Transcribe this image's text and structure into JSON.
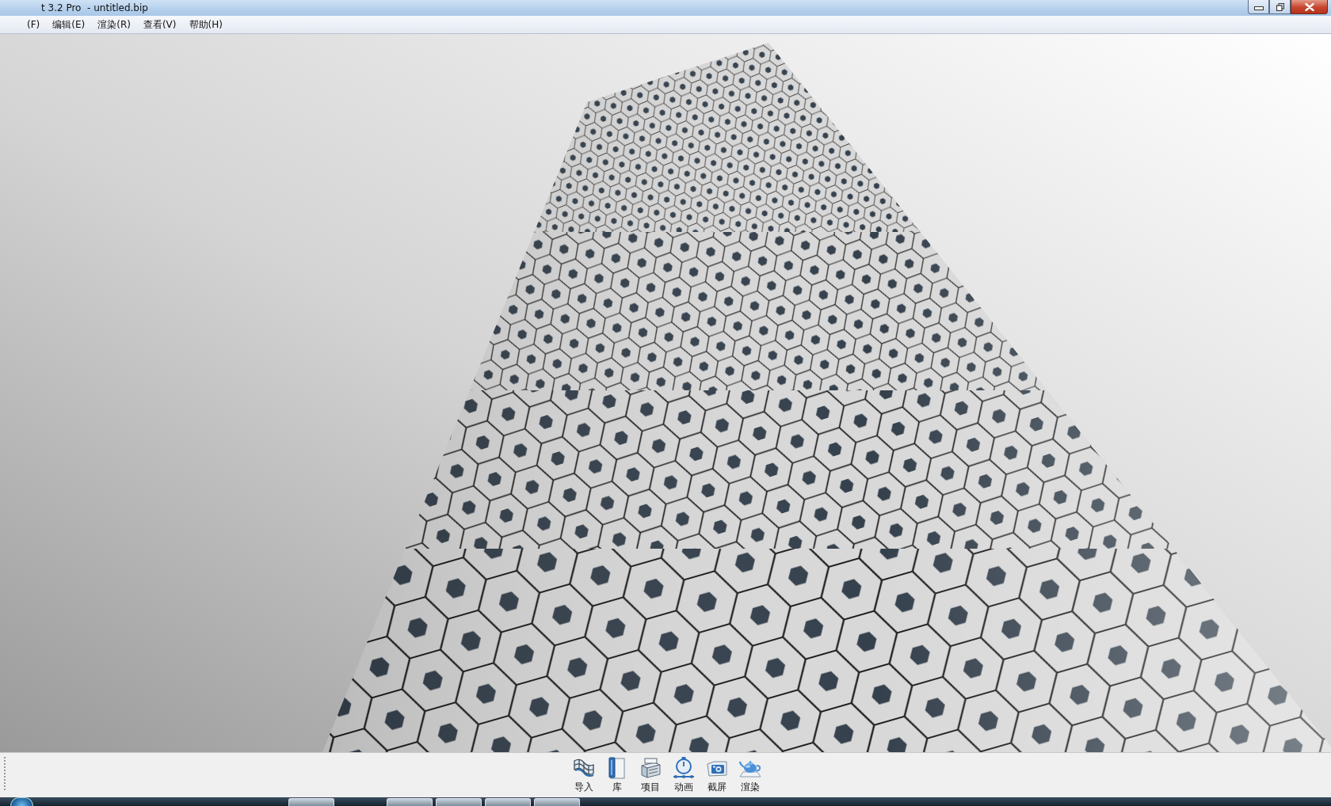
{
  "window": {
    "title": "t 3.2 Pro  - untitled.bip"
  },
  "menu": [
    {
      "label": "(F)"
    },
    {
      "label": "编辑(E)"
    },
    {
      "label": "渲染(R)"
    },
    {
      "label": "查看(V)"
    },
    {
      "label": "帮助(H)"
    }
  ],
  "toolbar": [
    {
      "label": "导入",
      "kind": "import"
    },
    {
      "label": "库",
      "kind": "library"
    },
    {
      "label": "项目",
      "kind": "project"
    },
    {
      "label": "动画",
      "kind": "animation"
    },
    {
      "label": "截屏",
      "kind": "screenshot"
    },
    {
      "label": "渲染",
      "kind": "render"
    }
  ]
}
